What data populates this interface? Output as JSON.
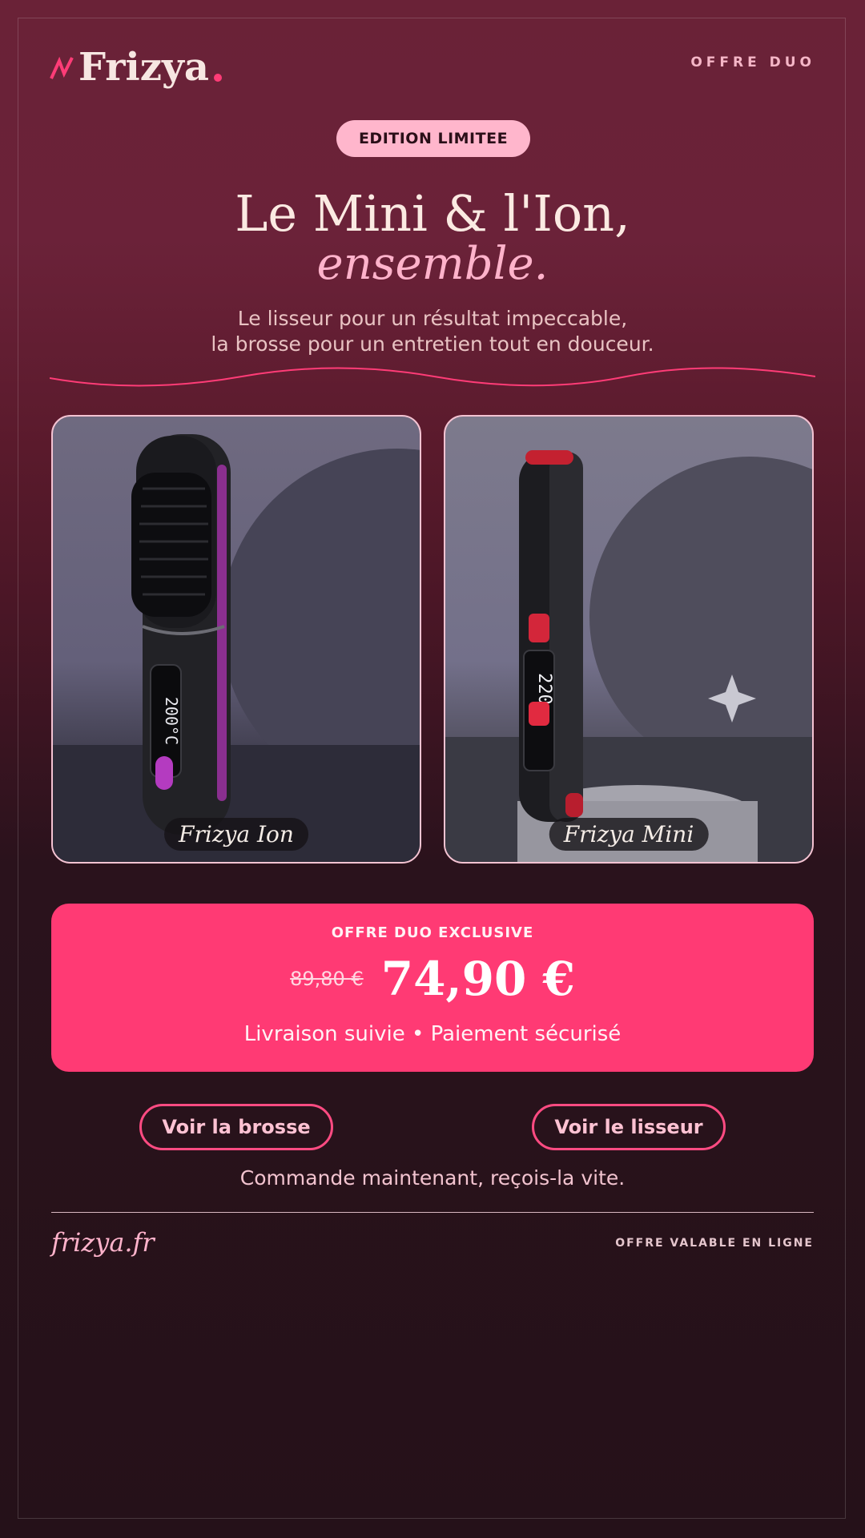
{
  "brand": {
    "name": "Frizya",
    "logo_icon": "wave-lightning-icon",
    "accent": "#ff3a74"
  },
  "header": {
    "tagline": "OFFRE DUO"
  },
  "badge": "EDITION LIMITEE",
  "hero": {
    "title": "Le Mini & l'Ion,",
    "title_em": "ensemble.",
    "subtitle_line1": "Le lisseur pour un résultat impeccable,",
    "subtitle_line2": "la brosse pour un entretien tout en douceur."
  },
  "products": [
    {
      "label": "Frizya Ion",
      "display": "200°C",
      "image": "heated-brush-image"
    },
    {
      "label": "Frizya Mini",
      "display": "220",
      "image": "mini-straightener-image"
    }
  ],
  "offer": {
    "kicker": "OFFRE DUO EXCLUSIVE",
    "old_price": "89,80 €",
    "new_price": "74,90 €",
    "footnote": "Livraison suivie • Paiement sécurisé"
  },
  "buttons": {
    "brush": "Voir la brosse",
    "straightener": "Voir le lisseur"
  },
  "cta": "Commande maintenant, reçois-la vite.",
  "footer": {
    "site": "frizya.fr",
    "note": "OFFRE VALABLE EN LIGNE"
  }
}
